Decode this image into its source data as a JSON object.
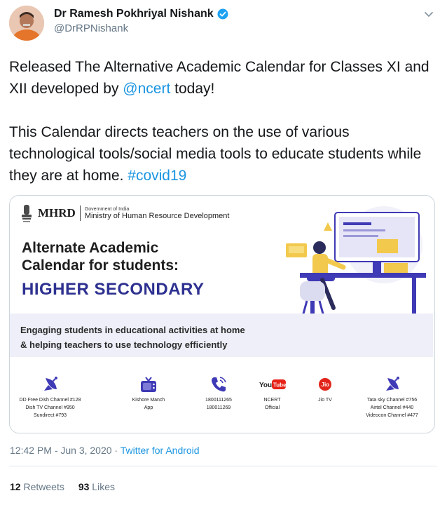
{
  "tweet": {
    "author_name": "Dr Ramesh Pokhriyal Nishank",
    "handle": "@DrRPNishank",
    "text": {
      "p1_before": "Released The Alternative Academic Calendar for Classes XI and XII developed by ",
      "p1_mention": "@ncert",
      "p1_after": " today!",
      "p2_before": "This Calendar directs teachers on the use of various technological tools/social media tools to educate students while they are at home. ",
      "p2_hashtag": "#covid19"
    },
    "card": {
      "mhrd": "MHRD",
      "gov_of_india": "Government of India",
      "ministry": "Ministry of Human Resource Development",
      "headline": "Alternate Academic Calendar for students:",
      "headline_line1": "Alternate Academic",
      "headline_line2": "Calendar for students:",
      "subheadline": "HIGHER SECONDARY",
      "band_line1": "Engaging students in educational activities at home",
      "band_line2": "& helping teachers to use technology efficiently",
      "icons": [
        {
          "name": "satellite-dish-icon",
          "label": "DD Free Dish Channel #128\nDish TV Channel #950\nSundirect #793"
        },
        {
          "name": "tv-icon",
          "label": "Kishore Manch\nApp"
        },
        {
          "name": "phone-icon",
          "label": "1800111265\n180011269"
        },
        {
          "name": "youtube-icon",
          "label": "NCERT\nOfficial"
        },
        {
          "name": "jio-tv-icon",
          "label": "Jio TV"
        },
        {
          "name": "satellite-dish-icon",
          "label": "Tata sky Channel #756\nAirtel Channel #440\nVideocon Channel #477"
        }
      ]
    },
    "timestamp": "12:42 PM - Jun 3, 2020",
    "meta_separator": " · ",
    "source": "Twitter for Android",
    "retweets_count": "12",
    "retweets_label": "Retweets",
    "likes_count": "93",
    "likes_label": "Likes"
  },
  "colors": {
    "link": "#1b95e0",
    "verified": "#1da1f2",
    "subheadline": "#2e3190",
    "icon_purple": "#3f3ab5",
    "youtube_red": "#e62117",
    "jio_red": "#e1251b"
  }
}
